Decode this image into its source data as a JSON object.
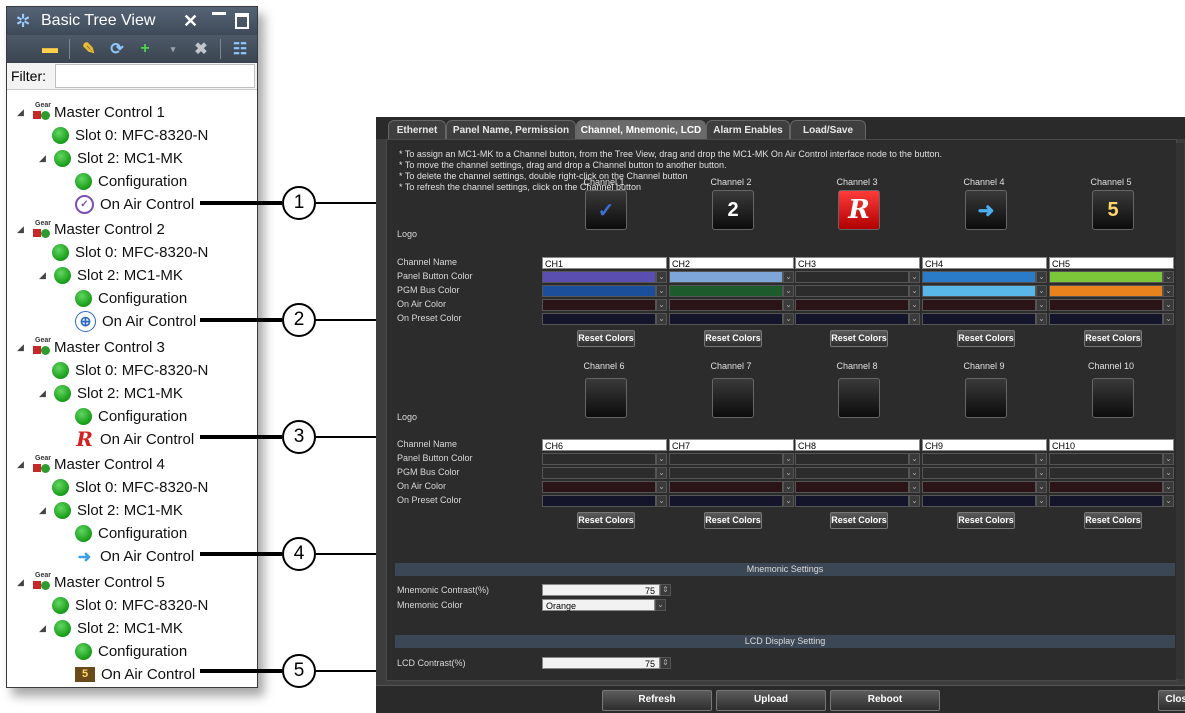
{
  "tree": {
    "title": "Basic Tree View",
    "filter_label": "Filter:",
    "filter_value": "",
    "groups": [
      {
        "name": "Master Control 1",
        "slot0": "Slot 0: MFC-8320-N",
        "slot2": "Slot 2: MC1-MK",
        "config": "Configuration",
        "oac": "On Air Control",
        "icon": "clock-logo-icon"
      },
      {
        "name": "Master Control 2",
        "slot0": "Slot 0: MFC-8320-N",
        "slot2": "Slot 2: MC1-MK",
        "config": "Configuration",
        "oac": "On Air Control",
        "icon": "globe-logo-icon"
      },
      {
        "name": "Master Control 3",
        "slot0": "Slot 0: MFC-8320-N",
        "slot2": "Slot 2: MC1-MK",
        "config": "Configuration",
        "oac": "On Air Control",
        "icon": "r-logo-icon"
      },
      {
        "name": "Master Control 4",
        "slot0": "Slot 0: MFC-8320-N",
        "slot2": "Slot 2: MC1-MK",
        "config": "Configuration",
        "oac": "On Air Control",
        "icon": "arrow-logo-icon"
      },
      {
        "name": "Master Control 5",
        "slot0": "Slot 0: MFC-8320-N",
        "slot2": "Slot 2: MC1-MK",
        "config": "Configuration",
        "oac": "On Air Control",
        "icon": "five-logo-icon"
      }
    ],
    "gear_text": "Gear"
  },
  "callouts": [
    "1",
    "2",
    "3",
    "4",
    "5"
  ],
  "config": {
    "tabs": [
      "Ethernet",
      "Panel Name, Permission",
      "Channel, Mnemonic, LCD",
      "Alarm Enables",
      "Load/Save"
    ],
    "active_tab": "Channel, Mnemonic, LCD",
    "instructions": [
      "* To assign an MC1-MK to a Channel button, from the Tree View, drag and drop the MC1-MK On Air Control interface node to the button.",
      "* To move the channel settings, drag and drop a Channel button to another button.",
      "* To delete the channel settings, double right-click on the Channel button",
      "* To refresh the channel settings, click on the Channel button"
    ],
    "row_labels": {
      "logo": "Logo",
      "channel_name": "Channel Name",
      "panel_button_color": "Panel Button Color",
      "pgm_bus_color": "PGM Bus Color",
      "on_air_color": "On Air Color",
      "on_preset_color": "On Preset Color"
    },
    "reset_label": "Reset Colors",
    "channels_top": [
      {
        "title": "Channel 1",
        "name": "CH1",
        "panel": "#5a4fb0",
        "pgm": "#1b4f9a",
        "onair": "#2a1418",
        "preset": "#14142a",
        "logo": "clock-logo-icon",
        "glyph": "✓",
        "glyph_color": "#3a6fd8"
      },
      {
        "title": "Channel 2",
        "name": "CH2",
        "panel": "#7fa6d8",
        "pgm": "#1d5a2c",
        "onair": "#2a1418",
        "preset": "#14142a",
        "logo": "globe-logo-icon",
        "glyph": "2",
        "glyph_color": "#ffffff"
      },
      {
        "title": "Channel 3",
        "name": "CH3",
        "panel": "#2c2c2c",
        "pgm": "#2c2c2c",
        "onair": "#2a1418",
        "preset": "#14142a",
        "logo": "r-logo-icon",
        "glyph": "R",
        "glyph_color": "#ffffff"
      },
      {
        "title": "Channel 4",
        "name": "CH4",
        "panel": "#2a7bc8",
        "pgm": "#5ab8e8",
        "onair": "#2a1418",
        "preset": "#14142a",
        "logo": "arrow-logo-icon",
        "glyph": "➜",
        "glyph_color": "#4ab0f0"
      },
      {
        "title": "Channel 5",
        "name": "CH5",
        "panel": "#7cc63a",
        "pgm": "#e8821c",
        "onair": "#2a1418",
        "preset": "#14142a",
        "logo": "five-logo-icon",
        "glyph": "5",
        "glyph_color": "#ffd86b"
      }
    ],
    "channels_bottom": [
      {
        "title": "Channel 6",
        "name": "CH6"
      },
      {
        "title": "Channel 7",
        "name": "CH7"
      },
      {
        "title": "Channel 8",
        "name": "CH8"
      },
      {
        "title": "Channel 9",
        "name": "CH9"
      },
      {
        "title": "Channel 10",
        "name": "CH10"
      }
    ],
    "mnemonic": {
      "section": "Mnemonic Settings",
      "contrast_label": "Mnemonic Contrast(%)",
      "contrast_value": "75",
      "color_label": "Mnemonic Color",
      "color_value": "Orange"
    },
    "lcd": {
      "section": "LCD Display Setting",
      "contrast_label": "LCD Contrast(%)",
      "contrast_value": "75"
    },
    "buttons": {
      "refresh": "Refresh",
      "upload": "Upload",
      "reboot": "Reboot",
      "close": "Close"
    }
  }
}
